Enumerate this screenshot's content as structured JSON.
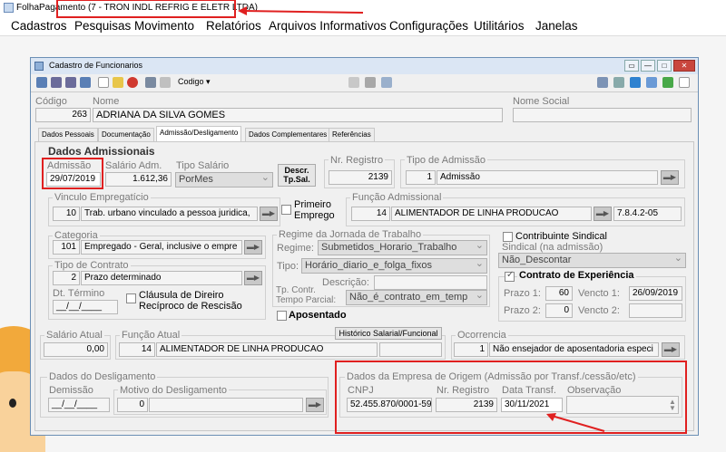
{
  "outer_window": {
    "title": "FolhaPagamento (7 - TRON INDL REFRIG E ELETR LTDA)"
  },
  "menu": [
    "Cadastros",
    "Pesquisas",
    "Movimento",
    "Relatórios",
    "Arquivos Informativos",
    "Configurações",
    "Utilitários",
    "Janelas"
  ],
  "window": {
    "title": "Cadastro de Funcionarios",
    "codigo_dropdown": "Codigo"
  },
  "header": {
    "codigo_label": "Código",
    "codigo": "263",
    "nome_label": "Nome",
    "nome": "ADRIANA DA SILVA GOMES",
    "nome_social_label": "Nome Social",
    "nome_social": ""
  },
  "tabs": [
    "Dados Pessoais",
    "Documentação",
    "Admissão/Desligamento",
    "Dados Complementares",
    "Referências"
  ],
  "admissao": {
    "section_title": "Dados Admissionais",
    "admissao_label": "Admissão",
    "admissao": "29/07/2019",
    "salario_label": "Salário Adm.",
    "salario": "1.612,36",
    "tipo_salario_label": "Tipo Salário",
    "tipo_salario": "PorMes",
    "descr_button": "Descr. Tp.Sal.",
    "nr_registro_label": "Nr. Registro",
    "nr_registro": "2139",
    "tipo_admissao_label": "Tipo de Admissão",
    "tipo_admissao_code": "1",
    "tipo_admissao": "Admissão",
    "vinculo_label": "Vinculo Empregatício",
    "vinculo_code": "10",
    "vinculo": "Trab. urbano vinculado a pessoa juridica,",
    "primeiro_emprego": "Primeiro Emprego",
    "funcao_adm_label": "Função Admissional",
    "funcao_adm_code": "14",
    "funcao_adm": "ALIMENTADOR DE LINHA PRODUCAO",
    "funcao_adm_cbo": "7.8.4.2-05",
    "categoria_label": "Categoria",
    "categoria_code": "101",
    "categoria": "Empregado - Geral, inclusive o empre",
    "regime_label": "Regime da Jornada de Trabalho",
    "regime_field_label": "Regime:",
    "regime": "Submetidos_Horario_Trabalho",
    "tipo_field_label": "Tipo:",
    "tipo": "Horário_diario_e_folga_fixos",
    "descricao_label": "Descrição:",
    "descricao": "",
    "tp_contr_label": "Tp. Contr. Tempo Parcial:",
    "tp_contr": "Não_é_contrato_em_temp",
    "contribuinte": "Contribuinte Sindical",
    "sindical_label": "Sindical (na admissão)",
    "sindical": "Não_Descontar",
    "tipo_contrato_label": "Tipo de Contrato",
    "tipo_contrato_code": "2",
    "tipo_contrato": "Prazo determinado",
    "dt_termino_label": "Dt. Término",
    "dt_termino": "__/__/____",
    "clausula": "Cláusula de Direiro Recíproco de Rescisão",
    "contrato_exp_label": "Contrato de Experiência",
    "prazo1_label": "Prazo 1:",
    "prazo1": "60",
    "vencto1_label": "Vencto 1:",
    "vencto1": "26/09/2019",
    "prazo2_label": "Prazo 2:",
    "prazo2": "0",
    "vencto2_label": "Vencto 2:",
    "vencto2": "",
    "aposentado": "Aposentado"
  },
  "atual": {
    "salario_label": "Salário Atual",
    "salario": "0,00",
    "funcao_label": "Função Atual",
    "funcao_code": "14",
    "funcao": "ALIMENTADOR DE LINHA PRODUCAO",
    "historico_button": "Histórico Salarial/Funcional",
    "ocorrencia_label": "Ocorrencia",
    "ocorrencia_code": "1",
    "ocorrencia": "Não ensejador de aposentadoria especi"
  },
  "desligamento": {
    "title": "Dados do Desligamento",
    "demissao_label": "Demissão",
    "demissao": "__/__/____",
    "motivo_label": "Motivo do Desligamento",
    "motivo_code": "0",
    "motivo": ""
  },
  "origem": {
    "title": "Dados da Empresa de Origem (Admissão por Transf./cessão/etc)",
    "cnpj_label": "CNPJ",
    "cnpj": "52.455.870/0001-59",
    "nr_registro_label": "Nr. Registro",
    "nr_registro": "2139",
    "data_transf_label": "Data Transf.",
    "data_transf": "30/11/2021",
    "observacao_label": "Observação",
    "observacao": ""
  },
  "colors": {
    "annotation_red": "#e02020",
    "title_bar": "#dbe6f4"
  }
}
